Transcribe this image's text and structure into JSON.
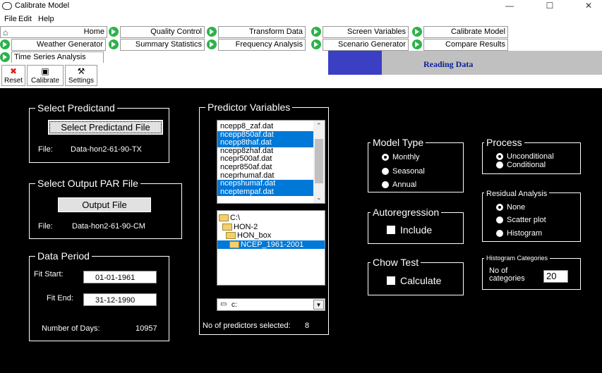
{
  "window": {
    "title": "Calibrate Model",
    "minimize": "—",
    "maximize": "☐",
    "close": "✕"
  },
  "menu": [
    "File",
    "Edit",
    "Help"
  ],
  "nav": {
    "home": "Home",
    "quality_control": "Quality Control",
    "transform_data": "Transform Data",
    "screen_variables": "Screen Variables",
    "calibrate_model": "Calibrate Model",
    "weather_generator": "Weather Generator",
    "summary_statistics": "Summary Statistics",
    "frequency_analysis": "Frequency Analysis",
    "scenario_generator": "Scenario Generator",
    "compare_results": "Compare Results",
    "time_series_analysis": "Time Series Analysis"
  },
  "status": {
    "text": "Reading Data"
  },
  "toolbar": {
    "reset": "Reset",
    "calibrate": "Calibrate",
    "settings": "Settings"
  },
  "predictand": {
    "title": "Select Predictand",
    "button": "Select Predictand File",
    "file_label": "File:",
    "file_value": "Data-hon2-61-90-TX"
  },
  "output": {
    "title": "Select Output PAR File",
    "button": "Output File",
    "file_label": "File:",
    "file_value": "Data-hon2-61-90-CM"
  },
  "period": {
    "title": "Data Period",
    "fit_start_label": "Fit Start:",
    "fit_start": "01-01-1961",
    "fit_end_label": "Fit End:",
    "fit_end": "31-12-1990",
    "days_label": "Number of Days:",
    "days": "10957"
  },
  "predictors": {
    "title": "Predictor Variables",
    "files": [
      {
        "name": "ncepp8_zaf.dat",
        "selected": false
      },
      {
        "name": "ncepp850af.dat",
        "selected": true
      },
      {
        "name": "ncepp8thaf.dat",
        "selected": true
      },
      {
        "name": "ncepp8zhaf.dat",
        "selected": false
      },
      {
        "name": "ncepr500af.dat",
        "selected": false
      },
      {
        "name": "ncepr850af.dat",
        "selected": false
      },
      {
        "name": "nceprhumaf.dat",
        "selected": false
      },
      {
        "name": "ncepshumaf.dat",
        "selected": true
      },
      {
        "name": "nceptempaf.dat",
        "selected": true
      }
    ],
    "dirs": [
      "C:\\",
      "HON-2",
      "HON_box",
      "NCEP_1961-2001"
    ],
    "drive": "c:",
    "count_label": "No of predictors selected:",
    "count": "8"
  },
  "model_type": {
    "title": "Model Type",
    "options": [
      "Monthly",
      "Seasonal",
      "Annual"
    ],
    "selected": "Monthly"
  },
  "process": {
    "title": "Process",
    "options": [
      "Unconditional",
      "Conditional"
    ],
    "selected": "Unconditional"
  },
  "residual": {
    "title": "Residual Analysis",
    "options": [
      "None",
      "Scatter plot",
      "Histogram"
    ],
    "selected": "None"
  },
  "autoregression": {
    "title": "Autoregression",
    "checkbox": "Include"
  },
  "chow": {
    "title": "Chow Test",
    "checkbox": "Calculate"
  },
  "histogram": {
    "title": "Histogram Categories",
    "label_line1": "No of",
    "label_line2": "categories",
    "value": "20"
  },
  "colors": {
    "progress_fill": "#3a3fc4",
    "selection": "#0078d7",
    "nav_arrow": "#2bb34a"
  }
}
